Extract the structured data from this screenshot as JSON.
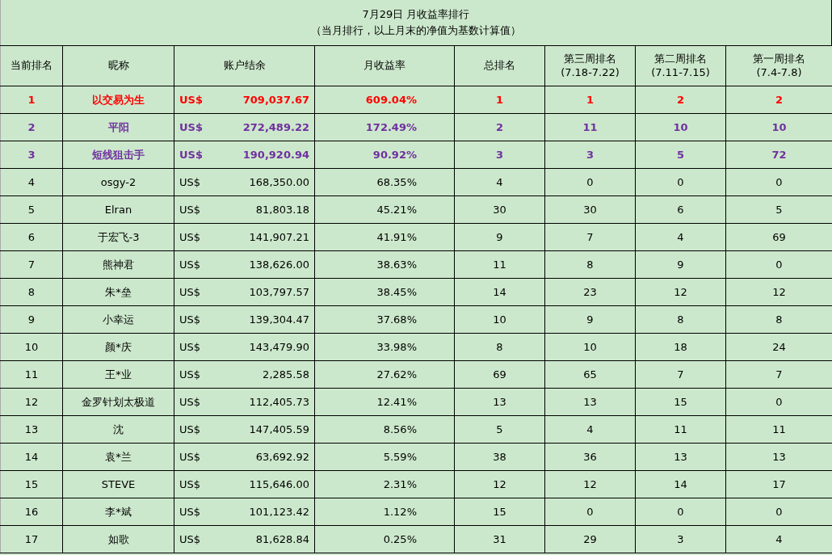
{
  "title": "7月29日 月收益率排行",
  "subtitle": "（当月排行，以上月末的净值为基数计算值）",
  "columns": [
    {
      "lines": [
        "当前排名"
      ]
    },
    {
      "lines": [
        "昵称"
      ]
    },
    {
      "lines": [
        "账户结余"
      ]
    },
    {
      "lines": [
        "月收益率"
      ]
    },
    {
      "lines": [
        "总排名"
      ]
    },
    {
      "lines": [
        "第三周排名",
        "(7.18-7.22)"
      ]
    },
    {
      "lines": [
        "第二周排名",
        "(7.11-7.15)"
      ]
    },
    {
      "lines": [
        "第一周排名",
        "(7.4-7.8)"
      ]
    }
  ],
  "rows": [
    {
      "color": "#ff0000",
      "bold": true,
      "rank": "1",
      "name": "以交易为生",
      "currency": "US$",
      "balance": "709,037.67",
      "rate": "609.04%",
      "total": "1",
      "week3": "1",
      "week2": "2",
      "week1": "2"
    },
    {
      "color": "#7030a0",
      "bold": true,
      "rank": "2",
      "name": "平阳",
      "currency": "US$",
      "balance": "272,489.22",
      "rate": "172.49%",
      "total": "2",
      "week3": "11",
      "week2": "10",
      "week1": "10"
    },
    {
      "color": "#7030a0",
      "bold": true,
      "rank": "3",
      "name": "短线狙击手",
      "currency": "US$",
      "balance": "190,920.94",
      "rate": "90.92%",
      "total": "3",
      "week3": "3",
      "week2": "5",
      "week1": "72"
    },
    {
      "color": "#000000",
      "bold": false,
      "rank": "4",
      "name": "osgy-2",
      "currency": "US$",
      "balance": "168,350.00",
      "rate": "68.35%",
      "total": "4",
      "week3": "0",
      "week2": "0",
      "week1": "0"
    },
    {
      "color": "#000000",
      "bold": false,
      "rank": "5",
      "name": "Elran",
      "currency": "US$",
      "balance": "81,803.18",
      "rate": "45.21%",
      "total": "30",
      "week3": "30",
      "week2": "6",
      "week1": "5"
    },
    {
      "color": "#000000",
      "bold": false,
      "rank": "6",
      "name": "于宏飞-3",
      "currency": "US$",
      "balance": "141,907.21",
      "rate": "41.91%",
      "total": "9",
      "week3": "7",
      "week2": "4",
      "week1": "69"
    },
    {
      "color": "#000000",
      "bold": false,
      "rank": "7",
      "name": "熊神君",
      "currency": "US$",
      "balance": "138,626.00",
      "rate": "38.63%",
      "total": "11",
      "week3": "8",
      "week2": "9",
      "week1": "0"
    },
    {
      "color": "#000000",
      "bold": false,
      "rank": "8",
      "name": "朱*垒",
      "currency": "US$",
      "balance": "103,797.57",
      "rate": "38.45%",
      "total": "14",
      "week3": "23",
      "week2": "12",
      "week1": "12"
    },
    {
      "color": "#000000",
      "bold": false,
      "rank": "9",
      "name": "小幸运",
      "currency": "US$",
      "balance": "139,304.47",
      "rate": "37.68%",
      "total": "10",
      "week3": "9",
      "week2": "8",
      "week1": "8"
    },
    {
      "color": "#000000",
      "bold": false,
      "rank": "10",
      "name": "颜*庆",
      "currency": "US$",
      "balance": "143,479.90",
      "rate": "33.98%",
      "total": "8",
      "week3": "10",
      "week2": "18",
      "week1": "24"
    },
    {
      "color": "#000000",
      "bold": false,
      "rank": "11",
      "name": "王*业",
      "currency": "US$",
      "balance": "2,285.58",
      "rate": "27.62%",
      "total": "69",
      "week3": "65",
      "week2": "7",
      "week1": "7"
    },
    {
      "color": "#000000",
      "bold": false,
      "rank": "12",
      "name": "金罗针划太极道",
      "currency": "US$",
      "balance": "112,405.73",
      "rate": "12.41%",
      "total": "13",
      "week3": "13",
      "week2": "15",
      "week1": "0"
    },
    {
      "color": "#000000",
      "bold": false,
      "rank": "13",
      "name": "沈",
      "currency": "US$",
      "balance": "147,405.59",
      "rate": "8.56%",
      "total": "5",
      "week3": "4",
      "week2": "11",
      "week1": "11"
    },
    {
      "color": "#000000",
      "bold": false,
      "rank": "14",
      "name": "袁*兰",
      "currency": "US$",
      "balance": "63,692.92",
      "rate": "5.59%",
      "total": "38",
      "week3": "36",
      "week2": "13",
      "week1": "13"
    },
    {
      "color": "#000000",
      "bold": false,
      "rank": "15",
      "name": "STEVE",
      "currency": "US$",
      "balance": "115,646.00",
      "rate": "2.31%",
      "total": "12",
      "week3": "12",
      "week2": "14",
      "week1": "17"
    },
    {
      "color": "#000000",
      "bold": false,
      "rank": "16",
      "name": "李*斌",
      "currency": "US$",
      "balance": "101,123.42",
      "rate": "1.12%",
      "total": "15",
      "week3": "0",
      "week2": "0",
      "week1": "0"
    },
    {
      "color": "#000000",
      "bold": false,
      "rank": "17",
      "name": "如歌",
      "currency": "US$",
      "balance": "81,628.84",
      "rate": "0.25%",
      "total": "31",
      "week3": "29",
      "week2": "3",
      "week1": "4"
    }
  ]
}
